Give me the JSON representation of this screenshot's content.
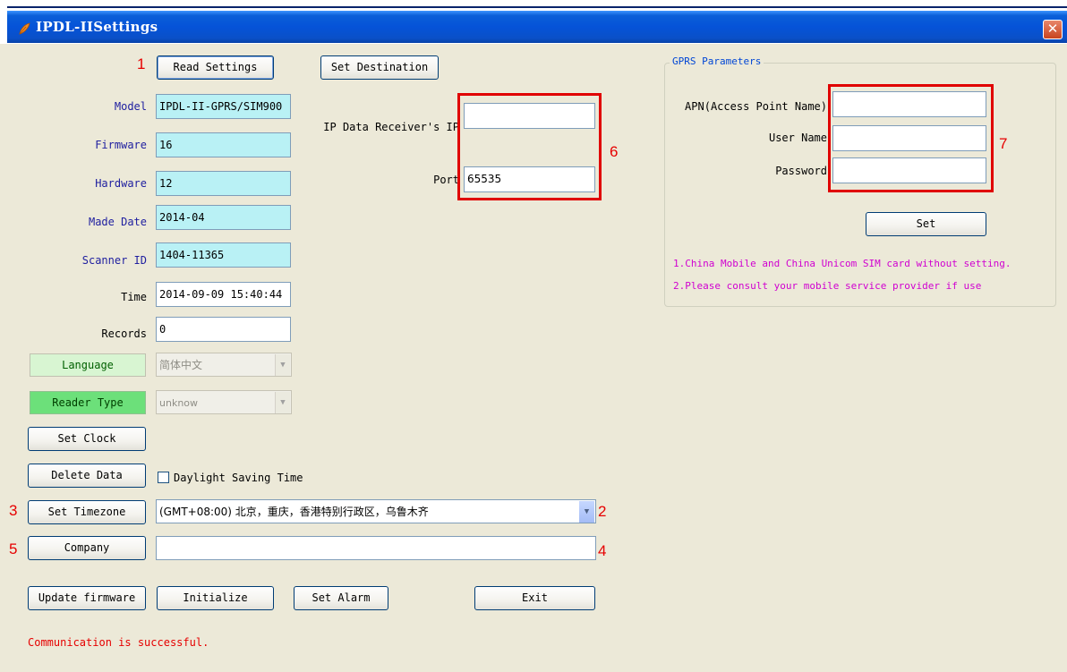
{
  "window": {
    "title": "IPDL-IISettings",
    "close_glyph": "✕",
    "app_icon": "app-feather-icon"
  },
  "buttons": {
    "read_settings": "Read Settings",
    "set_destination": "Set Destination",
    "set_clock": "Set Clock",
    "delete_data": "Delete Data",
    "set_timezone": "Set Timezone",
    "company": "Company",
    "update_firmware": "Update firmware",
    "initialize": "Initialize",
    "set_alarm": "Set Alarm",
    "exit": "Exit",
    "gprs_set": "Set"
  },
  "device": {
    "model_label": "Model",
    "model_value": "IPDL-II-GPRS/SIM900",
    "firmware_label": "Firmware",
    "firmware_value": "16",
    "hardware_label": "Hardware",
    "hardware_value": "12",
    "made_date_label": "Made Date",
    "made_date_value": "2014-04",
    "scanner_id_label": "Scanner ID",
    "scanner_id_value": "1404-11365",
    "time_label": "Time",
    "time_value": "2014-09-09 15:40:44",
    "records_label": "Records",
    "records_value": "0",
    "language_label": "Language",
    "language_value": "简体中文",
    "reader_type_label": "Reader Type",
    "reader_type_value": "unknow"
  },
  "destination": {
    "ip_label": "IP Data Receiver's IP",
    "ip_value": "",
    "port_label": "Port",
    "port_value": "65535"
  },
  "options": {
    "daylight_saving_label": "Daylight Saving Time",
    "daylight_saving_checked": false,
    "timezone_value": "(GMT+08:00) 北京，重庆，香港特别行政区，乌鲁木齐",
    "company_value": ""
  },
  "gprs": {
    "group_title": "GPRS Parameters",
    "apn_label": "APN(Access Point Name)",
    "apn_value": "",
    "username_label": "User Name",
    "username_value": "",
    "password_label": "Password",
    "password_value": "",
    "note1": "1.China Mobile and China Unicom SIM card without setting.",
    "note2": "2.Please consult your mobile service provider if use"
  },
  "status": {
    "message": "Communication is successful."
  },
  "annotations": {
    "m1": "1",
    "m2": "2",
    "m3": "3",
    "m4": "4",
    "m5": "5",
    "m6": "6",
    "m7": "7"
  },
  "colors": {
    "status_text": "#e60000",
    "annotation_red": "#e00000",
    "readonly_cyan": "#b9f1f5",
    "note_magenta": "#d000d0"
  }
}
